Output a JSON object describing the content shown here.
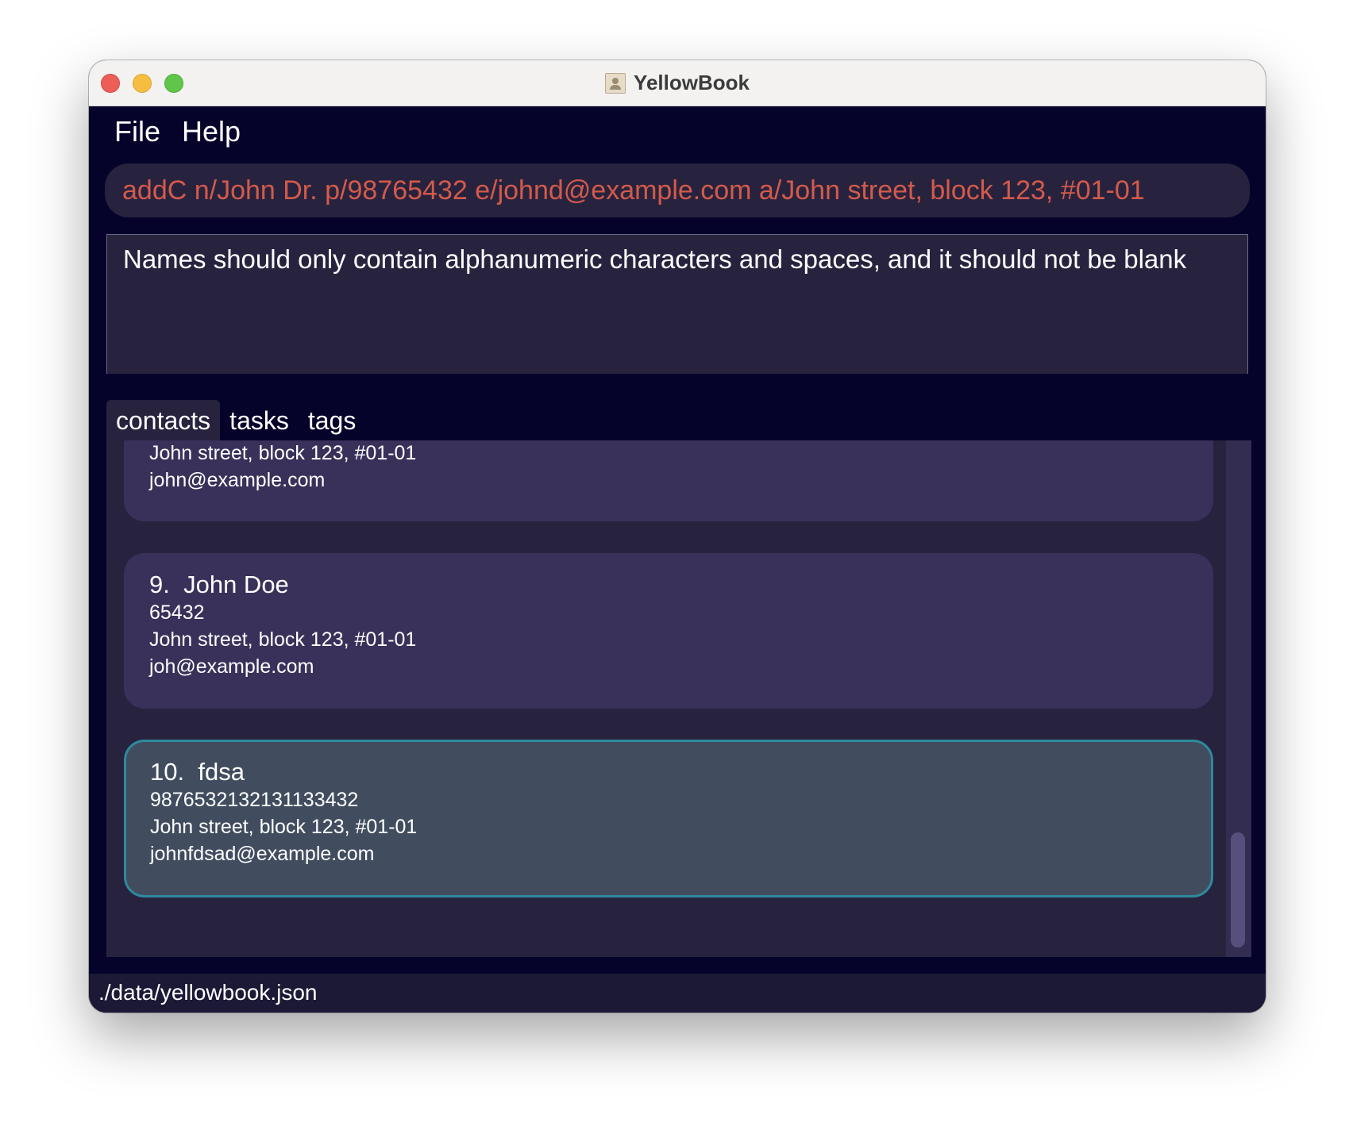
{
  "window": {
    "title": "YellowBook"
  },
  "menu": {
    "file_label": "File",
    "help_label": "Help"
  },
  "command": {
    "value": "addC n/John Dr. p/98765432 e/johnd@example.com a/John street, block 123, #01-01"
  },
  "result": {
    "message": "Names should only contain alphanumeric characters and spaces, and it should not be blank"
  },
  "tabs": [
    {
      "label": "contacts",
      "active": true
    },
    {
      "label": "tasks",
      "active": false
    },
    {
      "label": "tags",
      "active": false
    }
  ],
  "contacts": [
    {
      "index": "",
      "name": "",
      "phone": "",
      "address": "John street, block 123, #01-01",
      "email": "john@example.com"
    },
    {
      "index": "9.",
      "name": "John Doe",
      "phone": "65432",
      "address": "John street, block 123, #01-01",
      "email": "joh@example.com"
    },
    {
      "index": "10.",
      "name": "fdsa",
      "phone": "9876532132131133432",
      "address": "John street, block 123, #01-01",
      "email": "johnfdsad@example.com",
      "selected": true
    }
  ],
  "status": {
    "path": "./data/yellowbook.json"
  },
  "colors": {
    "background": "#06032b",
    "panel": "#27233f",
    "card": "#39315a",
    "selected_card": "#414d5f",
    "command_text": "#d45a4a",
    "selected_border": "#2e8a9c"
  }
}
